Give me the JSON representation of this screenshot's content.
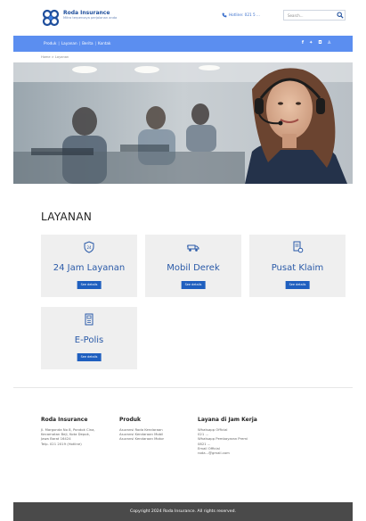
{
  "header": {
    "brand_name": "Roda Insurance",
    "brand_tagline": "Mitra terpercaya perjalanan anda",
    "hotline": "Hotline: 021 5 ...",
    "search_placeholder": "Search..."
  },
  "nav": {
    "items": [
      "Produk",
      "Layanan",
      "Berita",
      "Kontak"
    ],
    "social_icons": [
      "facebook-icon",
      "twitter-icon",
      "instagram-icon",
      "linkedin-icon"
    ]
  },
  "breadcrumb": {
    "home": "Home",
    "current": "Layanan"
  },
  "section": {
    "title": "LAYANAN"
  },
  "services": [
    {
      "title": "24 Jam Layanan",
      "button": "See details",
      "icon": "24h-badge-icon"
    },
    {
      "title": "Mobil Derek",
      "button": "See details",
      "icon": "tow-truck-icon"
    },
    {
      "title": "Pusat Klaim",
      "button": "See details",
      "icon": "claim-document-icon"
    },
    {
      "title": "E-Polis",
      "button": "See details",
      "icon": "e-policy-icon"
    }
  ],
  "footer": {
    "col1": {
      "heading": "Roda Insurance",
      "lines": [
        "Jl. Margonda No 8, Pondok Cina,",
        "Kecamatan Beji, Kota Depok,",
        "Jawa Barat 16424",
        "Telp. 021 2019 (Hotline)"
      ]
    },
    "col2": {
      "heading": "Produk",
      "lines": [
        "Asuransi Roda Kendaraan",
        "Asuransi Kendaraan Mobil",
        "Asuransi Kendaraan Motor"
      ]
    },
    "col3": {
      "heading": "Layana di Jam Kerja",
      "lines": [
        "Whatsapp Official",
        "021 ...",
        "Whatsapp Pembayaran Premi",
        "0821 ...",
        "Email Official",
        "roda...@gmail.com"
      ]
    },
    "copyright": "Copyright 2024 Roda Insurance. All rights reserved."
  },
  "colors": {
    "accent": "#5b8ef0",
    "button": "#1f5fbf",
    "card_bg": "#efefef",
    "footer_bar": "#4a4a4a"
  }
}
